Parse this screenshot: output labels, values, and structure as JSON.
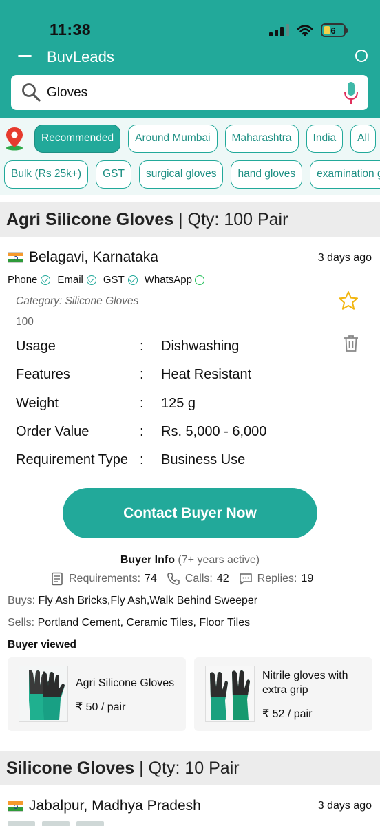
{
  "status_bar": {
    "time": "11:38",
    "battery": "6"
  },
  "header": {
    "app_title": "BuyLeads"
  },
  "search": {
    "value": "Gloves"
  },
  "filters": {
    "row1": [
      "Recommended",
      "Around Mumbai",
      "Maharashtra",
      "India",
      "All"
    ],
    "row2": [
      "Bulk (Rs 25k+)",
      "GST",
      "surgical gloves",
      "hand gloves",
      "examination gloves"
    ],
    "active": "Recommended"
  },
  "listing": {
    "title": "Agri Silicone Gloves",
    "qty": "| Qty: 100 Pair",
    "location": "Belagavi, Karnataka",
    "posted": "3 days ago",
    "verified": [
      "Phone",
      "Email",
      "GST",
      "WhatsApp"
    ],
    "category": "Category: Silicone Gloves",
    "qty_small": "100",
    "specs": [
      {
        "key": "Usage",
        "value": "Dishwashing"
      },
      {
        "key": "Features",
        "value": "Heat Resistant"
      },
      {
        "key": "Weight",
        "value": "125 g"
      },
      {
        "key": "Order Value",
        "value": "Rs. 5,000 - 6,000"
      },
      {
        "key": "Requirement Type",
        "value": "Business Use"
      }
    ],
    "separator": ":",
    "cta": "Contact Buyer Now",
    "buyer_info_label": "Buyer Info",
    "buyer_active": "(7+ years active)",
    "stats": {
      "requirements_label": "Requirements:",
      "requirements": "74",
      "calls_label": "Calls:",
      "calls": "42",
      "replies_label": "Replies:",
      "replies": "19"
    },
    "buys_label": "Buys:",
    "buys": "Fly Ash Bricks,Fly Ash,Walk Behind Sweeper",
    "sells_label": "Sells:",
    "sells": "Portland Cement, Ceramic Tiles, Floor Tiles",
    "buyer_viewed_label": "Buyer viewed",
    "viewed": [
      {
        "name": "Agri Silicone Gloves",
        "price": "₹ 50 / pair"
      },
      {
        "name": "Nitrile gloves with extra grip",
        "price": "₹ 52 / pair"
      }
    ]
  },
  "listing2": {
    "title": "Silicone Gloves",
    "qty": "| Qty: 10 Pair",
    "location": "Jabalpur, Madhya Pradesh",
    "posted": "3 days ago"
  },
  "colors": {
    "accent": "#22a99a",
    "star": "#f2b50f",
    "mic": "#e0315d"
  }
}
